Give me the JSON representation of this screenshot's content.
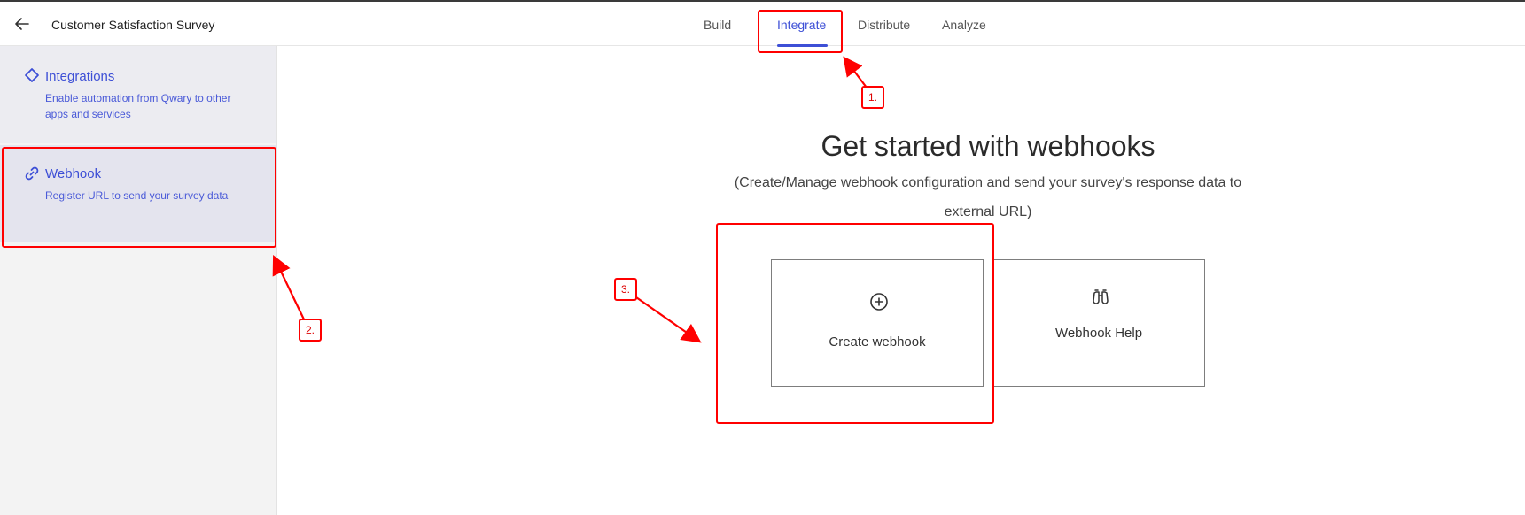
{
  "header": {
    "survey_title": "Customer Satisfaction Survey",
    "tabs": [
      {
        "label": "Build"
      },
      {
        "label": "Integrate",
        "active": true
      },
      {
        "label": "Distribute"
      },
      {
        "label": "Analyze"
      }
    ]
  },
  "sidebar": {
    "items": [
      {
        "title": "Integrations",
        "description": "Enable automation from Qwary to other apps and services",
        "icon": "diamond-icon"
      },
      {
        "title": "Webhook",
        "description": "Register URL to send your survey data",
        "icon": "link-icon"
      }
    ]
  },
  "main": {
    "title": "Get started with webhooks",
    "subtitle": "(Create/Manage webhook configuration and send your survey's response data to external URL)",
    "cards": [
      {
        "label": "Create webhook",
        "icon": "plus-circle-icon"
      },
      {
        "label": "Webhook Help",
        "icon": "binoculars-icon"
      }
    ]
  },
  "annotations": {
    "callouts": [
      "1.",
      "2.",
      "3."
    ],
    "color": "#ff0000"
  },
  "colors": {
    "accent": "#3d4fd6",
    "annotation": "#ff0000"
  }
}
